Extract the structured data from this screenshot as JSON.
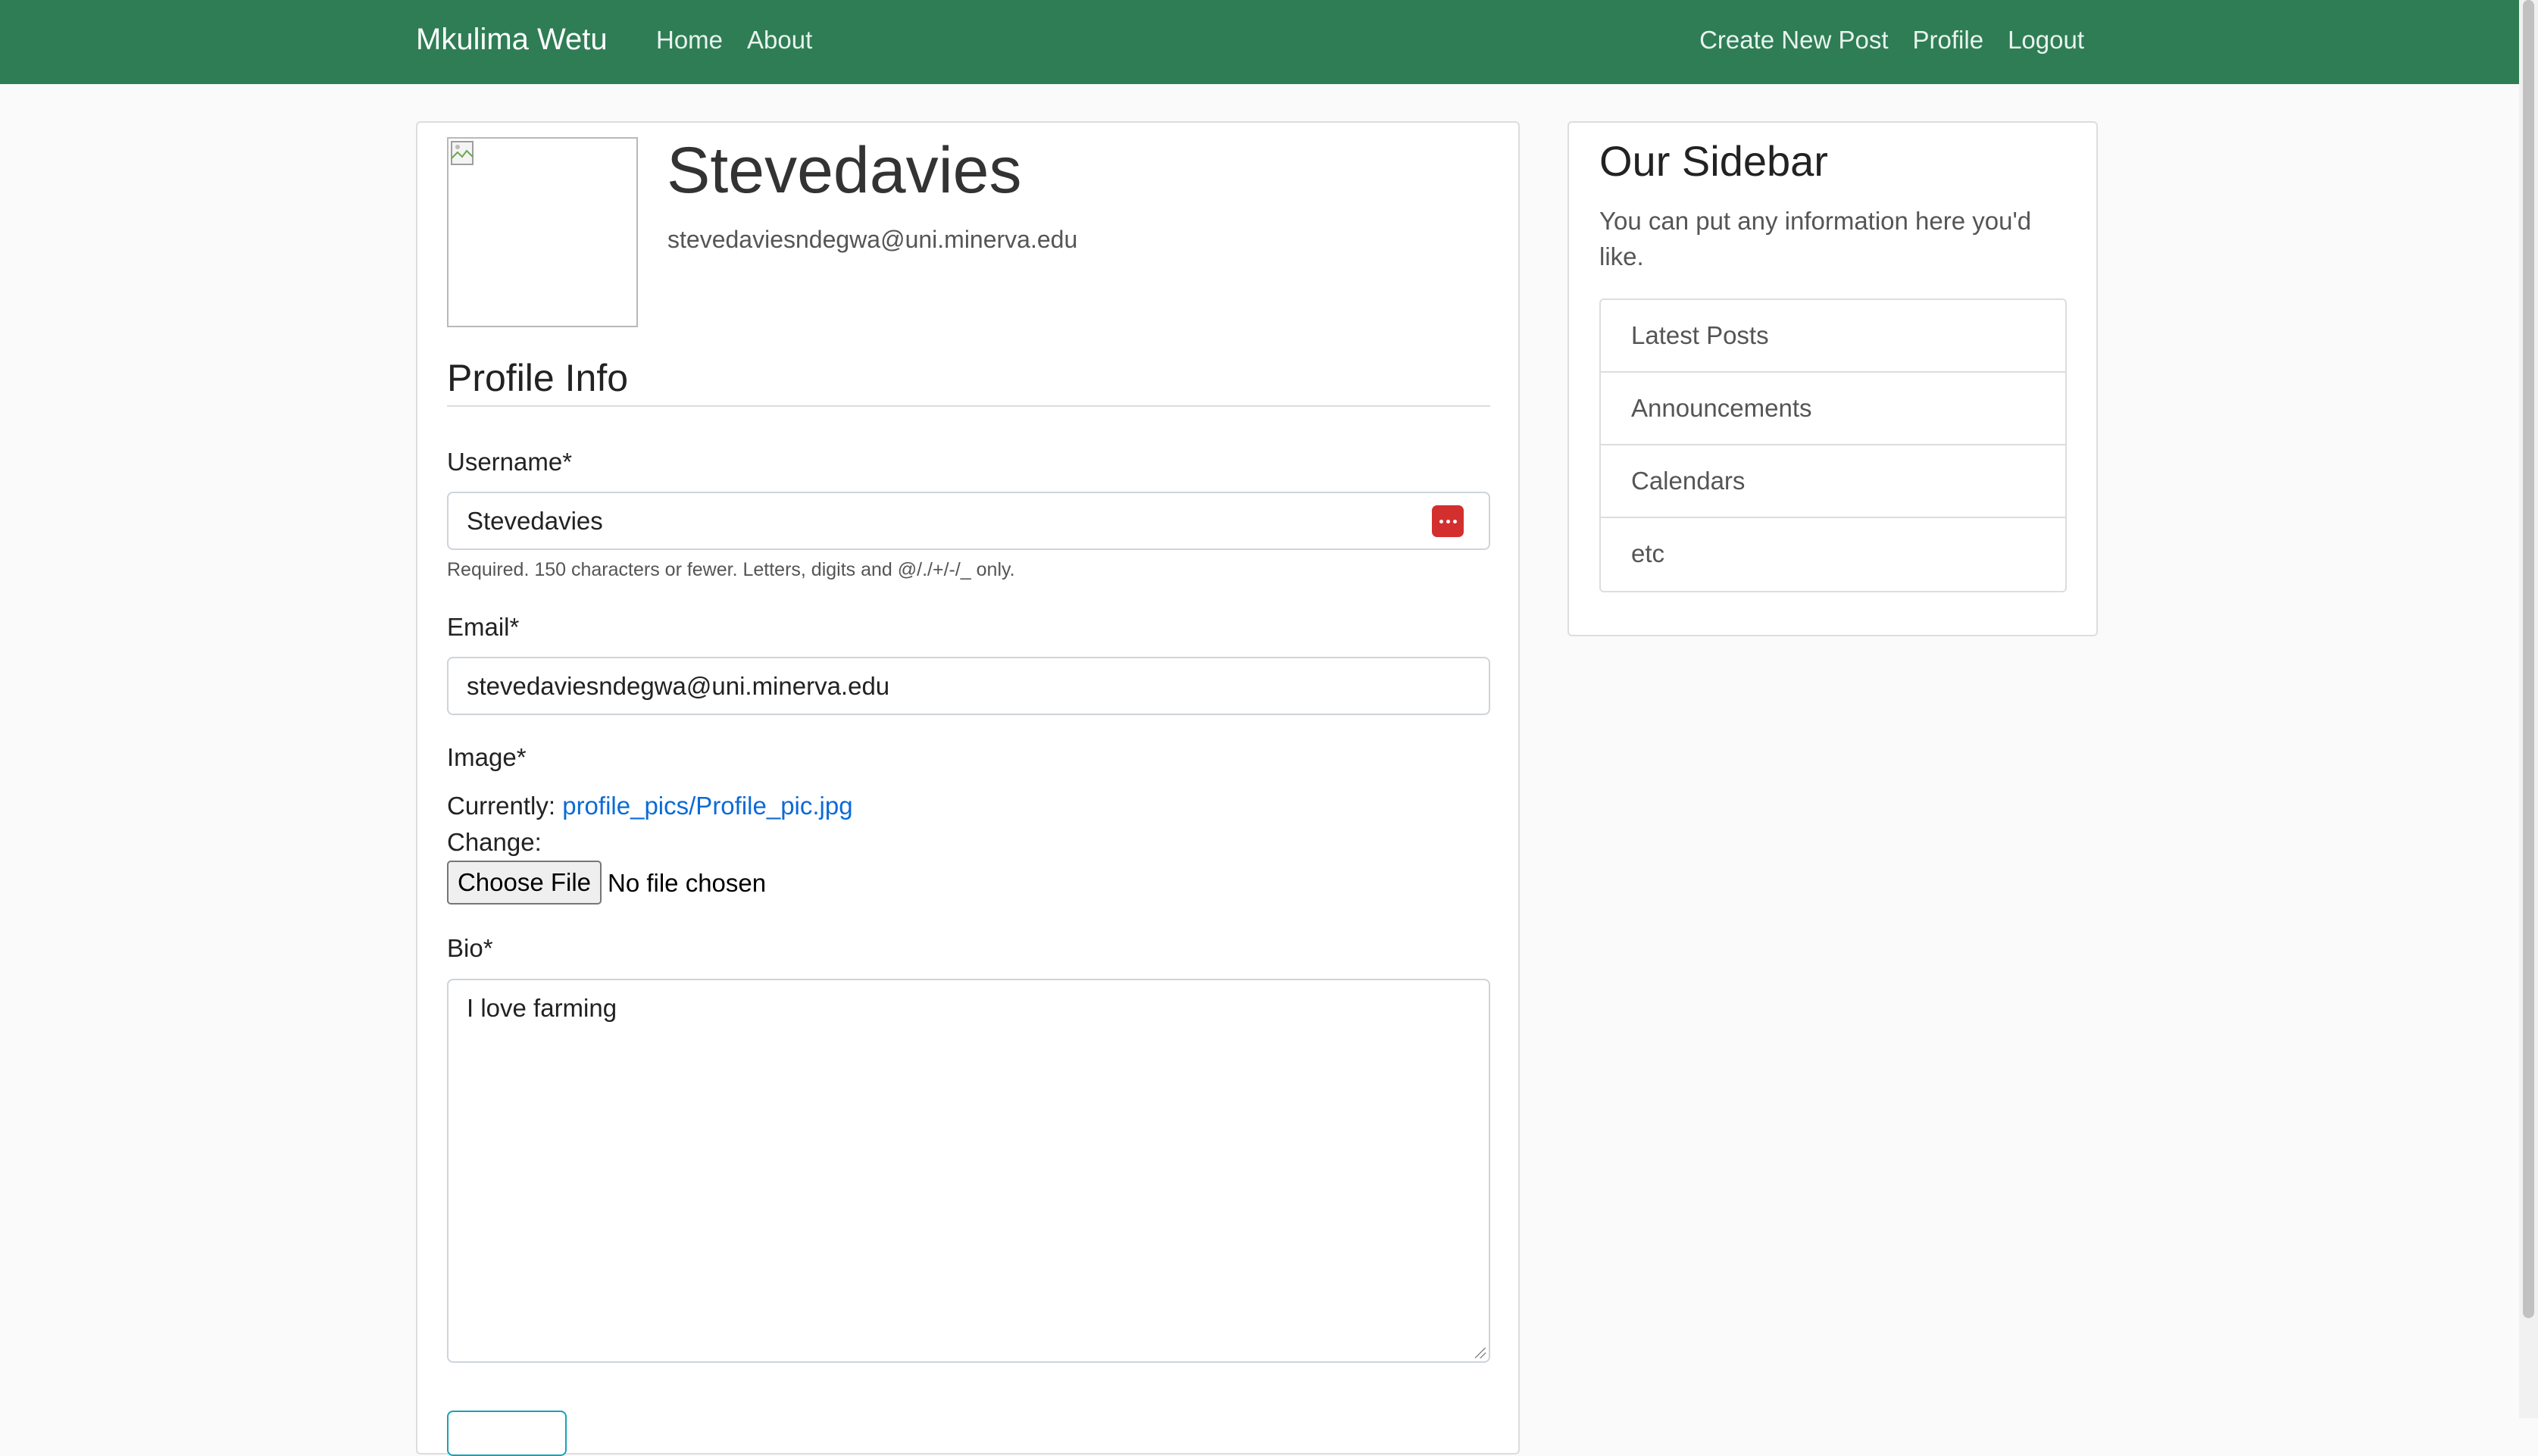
{
  "navbar": {
    "brand": "Mkulima Wetu",
    "left_links": [
      "Home",
      "About"
    ],
    "right_links": [
      "Create New Post",
      "Profile",
      "Logout"
    ],
    "background_color": "#2e7d55"
  },
  "profile": {
    "username": "Stevedavies",
    "email": "stevedaviesndegwa@uni.minerva.edu",
    "avatar_icon": "broken-image-icon"
  },
  "form": {
    "section_title": "Profile Info",
    "username_label": "Username*",
    "username_value": "Stevedavies",
    "username_help": "Required. 150 characters or fewer. Letters, digits and @/./+/-/_ only.",
    "password_manager_icon": "password-manager-icon",
    "email_label": "Email*",
    "email_value": "stevedaviesndegwa@uni.minerva.edu",
    "image_label": "Image*",
    "currently_label": "Currently:",
    "current_image_link": "profile_pics/Profile_pic.jpg",
    "change_label": "Change:",
    "choose_file_label": "Choose File",
    "file_status": "No file chosen",
    "bio_label": "Bio*",
    "bio_value": "I love farming",
    "submit_button_color": "#17a2b8"
  },
  "sidebar": {
    "title": "Our Sidebar",
    "description": "You can put any information here you'd like.",
    "items": [
      "Latest Posts",
      "Announcements",
      "Calendars",
      "etc"
    ]
  },
  "colors": {
    "link": "#0b6bd6",
    "password_badge": "#d32f2f"
  }
}
